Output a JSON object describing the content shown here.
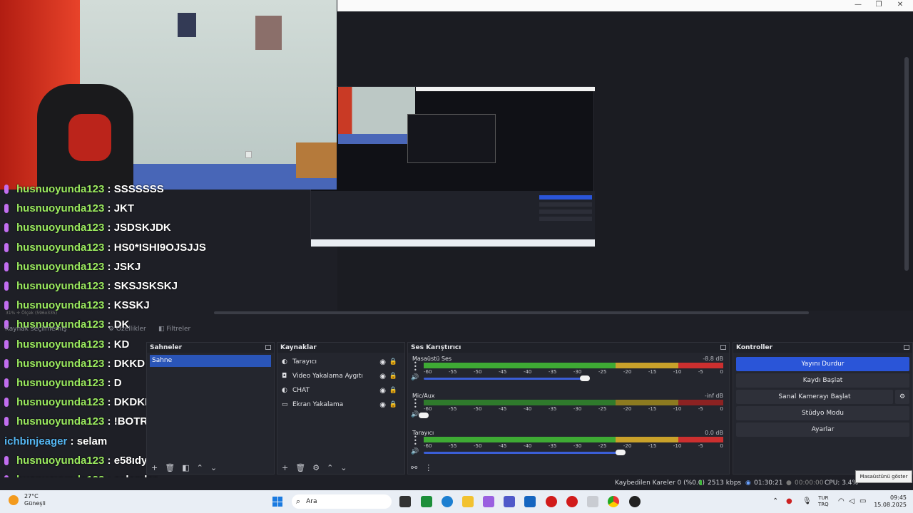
{
  "chat": [
    {
      "user": "husnuoyunda123",
      "msg": "SSSSSSS",
      "badge": true,
      "alt": false
    },
    {
      "user": "husnuoyunda123",
      "msg": "JKT",
      "badge": true,
      "alt": false
    },
    {
      "user": "husnuoyunda123",
      "msg": "JSDSKJDK",
      "badge": true,
      "alt": false
    },
    {
      "user": "husnuoyunda123",
      "msg": "HS0*ISHI9OJSJJS",
      "badge": true,
      "alt": false
    },
    {
      "user": "husnuoyunda123",
      "msg": "JSKJ",
      "badge": true,
      "alt": false
    },
    {
      "user": "husnuoyunda123",
      "msg": "SKSJSKSKJ",
      "badge": true,
      "alt": false
    },
    {
      "user": "husnuoyunda123",
      "msg": "KSSKJ",
      "badge": true,
      "alt": false
    },
    {
      "user": "husnuoyunda123",
      "msg": "DK",
      "badge": true,
      "alt": false
    },
    {
      "user": "husnuoyunda123",
      "msg": "KD",
      "badge": true,
      "alt": false
    },
    {
      "user": "husnuoyunda123",
      "msg": "DKKD",
      "badge": true,
      "alt": false
    },
    {
      "user": "husnuoyunda123",
      "msg": "D",
      "badge": true,
      "alt": false
    },
    {
      "user": "husnuoyunda123",
      "msg": "DKDKKDKDK",
      "badge": true,
      "alt": false
    },
    {
      "user": "husnuoyunda123",
      "msg": "!BOTRİXC",
      "badge": true,
      "alt": false
    },
    {
      "user": "ichbinjeager",
      "msg": "selam",
      "badge": false,
      "alt": true
    },
    {
      "user": "husnuoyunda123",
      "msg": "e58ıdy",
      "badge": true,
      "alt": false
    },
    {
      "user": "husnuoyunda123",
      "msg": "selamlar",
      "badge": true,
      "alt": false
    }
  ],
  "separator": " : ",
  "preview_scale": "31%  ✛  Ölçek (596x335)",
  "source_bar": {
    "none": "Kaynak seçilmemiş",
    "props": "⚙ Özellikler",
    "filters": "◧ Filtreler"
  },
  "scenes": {
    "title": "Sahneler",
    "items": [
      "Sahne"
    ]
  },
  "sources": {
    "title": "Kaynaklar",
    "items": [
      {
        "icon": "browser-icon",
        "glyph": "◐",
        "label": "Tarayıcı"
      },
      {
        "icon": "camera-icon",
        "glyph": "◘",
        "label": "Video Yakalama Aygıtı"
      },
      {
        "icon": "browser-icon",
        "glyph": "◐",
        "label": "CHAT"
      },
      {
        "icon": "monitor-icon",
        "glyph": "▭",
        "label": "Ekran Yakalama"
      }
    ]
  },
  "mixer": {
    "title": "Ses Karıştırıcı",
    "channels": [
      {
        "name": "Masaüstü Ses",
        "db": "-8.8 dB",
        "vol": 0.82,
        "hot": true
      },
      {
        "name": "Mic/Aux",
        "db": "-inf dB",
        "vol": 0.0,
        "hot": false
      },
      {
        "name": "Tarayıcı",
        "db": "0.0 dB",
        "vol": 1.0,
        "hot": true
      }
    ],
    "ticks": [
      "-60",
      "-55",
      "-50",
      "-45",
      "-40",
      "-35",
      "-30",
      "-25",
      "-20",
      "-15",
      "-10",
      "-5",
      "0"
    ]
  },
  "controls": {
    "title": "Kontroller",
    "stop_stream": "Yayını Durdur",
    "start_rec": "Kaydı Başlat",
    "virtual_cam": "Sanal Kamerayı Başlat",
    "studio": "Stüdyo Modu",
    "settings": "Ayarlar"
  },
  "status": {
    "dropped": "Kaybedilen Kareler 0 (%0.0)",
    "bitrate": "2513 kbps",
    "live": "01:30:21",
    "rec": "00:00:00",
    "cpu": "CPU: 3.4%"
  },
  "tooltip": "Masaüstünü göster",
  "weather": {
    "temp": "27°C",
    "label": "Güneşli"
  },
  "search_placeholder": "Ara",
  "lang": {
    "l1": "TUR",
    "l2": "TRQ"
  },
  "clock": {
    "time": "09:45",
    "date": "15.08.2025"
  },
  "colors": {
    "accent": "#2a55d8",
    "chat_user": "#9bea5f",
    "chat_user_alt": "#55b6f2",
    "badge": "#c26ef0"
  }
}
